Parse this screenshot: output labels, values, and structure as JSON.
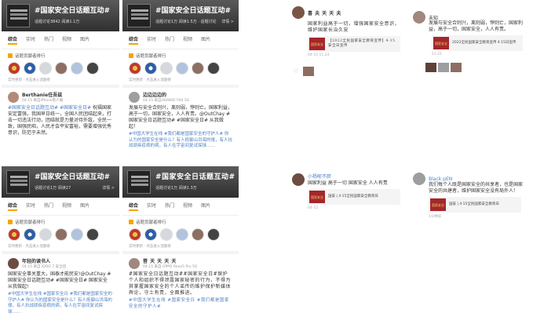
{
  "topic_panel_a": {
    "title": "#国家安全日话题互动#",
    "meta": "话题讨论3842  阅读1.1万",
    "tabs": [
      "综合",
      "实时",
      "热门",
      "视频",
      "图片"
    ],
    "section": "话题贡献者排行",
    "hint": "实时更新 · 点击进入话题榜",
    "post_name": "Berthanie任吾兹",
    "post_sub": "04-15 来自iPhone客户端",
    "post_tags": "#国家安全日话题互动#  #国家安全日#",
    "post_text": "祝福国家安定富强，我国早日统一，全国人民团结起来，打击一切违法行动，团结就是力量对待外敌，全民一致，国强民昭，人民才会平安富裕，需要增强优秀意识，防范于未然。"
  },
  "topic_panel_b": {
    "title": "#国家安全日话题互动#",
    "meta": "话题讨论1万  阅读1.5万 · 话题讨论",
    "more": "详情 >",
    "tabs": [
      "综合",
      "实时",
      "热门",
      "视频",
      "图片"
    ],
    "section": "话题贡献者排行",
    "hint": "实时更新 · 点击进入话题榜",
    "post_name": "边边边边的",
    "post_sub": "04-15 来自HUAWEI P40 5G",
    "post_text": "发展与安全合则兴，离则弱，悖则亡。国家利益，高于一切，国家安全，人人有责。@OutChay #国家安全日话题互动# #国家安全日# 从我做起！",
    "post_text2": "#中国大学生在线  #我们都是国家安全的守护人# 你认为的国家安全是什么？有人抵御山洪海的侵，有人抗战顽疾疫病的病，有人在宇宙间复试探球……"
  },
  "topic_panel_c": {
    "title": "#国家安全日话题互动#",
    "meta": "话题讨论1万  阅读27",
    "more": "详情 >",
    "tabs": [
      "综合",
      "实时",
      "热门",
      "视频",
      "图片"
    ],
    "section": "话题贡献者排行",
    "hint": "实时更新 · 点击进入话题榜",
    "post_name": "年轻的读书人",
    "post_sub": "04-15 来自 iQOO 7 安全团",
    "post_text": "国家安全事关重大，国泰才能民安!@OutChay #国家安全日话题互动# #国家安全日# 国家安全 从我做起!",
    "post_text2": "#中国大学生在线  #国家安全日  #我们都是国家安全的守护人# 你认为的国家安全是什么？有人抵御山洪海的侵，有人抗战顽疾疫病的病，有人在宇宙间复试探球……"
  },
  "topic_panel_d": {
    "title": "#国家安全日话题互动#",
    "meta": "话题讨论1万  阅读1.3万",
    "tabs": [
      "综合",
      "实时",
      "热门",
      "视频",
      "图片"
    ],
    "section": "话题贡献者排行",
    "hint": "实时更新 · 点击进入话题榜",
    "post_name": "菩 天 天 天 天",
    "post_sub": "04-15 来自 OPPO Reno5 Pro 5G",
    "post_text": "#国家安全日话题互动##国家安全日#保护个人和组织不得泄露国家秘密的行为，不得为其掌握国家安全的个人谣传的维护保护新媒体舆论，守土有责，全面推进。",
    "post_text2": "#中国大学生在线  #国家安全日  #我们都是国家安全的守护人#"
  },
  "comment_1": {
    "name": "喜 夫 天 天 夫",
    "text": "国家利益高于一切，增强国家安全意识，维护国家长治久安",
    "card_img": "国家安全",
    "card_text": "【2022全民国家安全教育宣传】4·15安全日宣传",
    "time": "04-15 11:24"
  },
  "comment_2": {
    "name": "未知",
    "text": "发展与安全合则兴，离则弱，悖则亡，国家利益，高于一切，国家安全，人人有责。",
    "card_img": "国家安全",
    "card_text": "2022全民国家安全教育宣传 4·15日宣传",
    "time": "11:21"
  },
  "comment_3": {
    "name": "小杨呢不胖",
    "text": "国家利益 高于一切 国家安全 人人有责",
    "card_img": "国家安全",
    "card_text": "国安 | 4·15全民国家安全教育日",
    "time": "04-15"
  },
  "comment_4": {
    "name": "Black pEN",
    "text": "我们每个人既是国家安全的共享者，也是国家安全的共建者，维护国家安全没有局外人！",
    "card_img": "国家安全",
    "card_text": "国安 | 4·15全民国家安全教育日",
    "time": "1分钟前"
  }
}
